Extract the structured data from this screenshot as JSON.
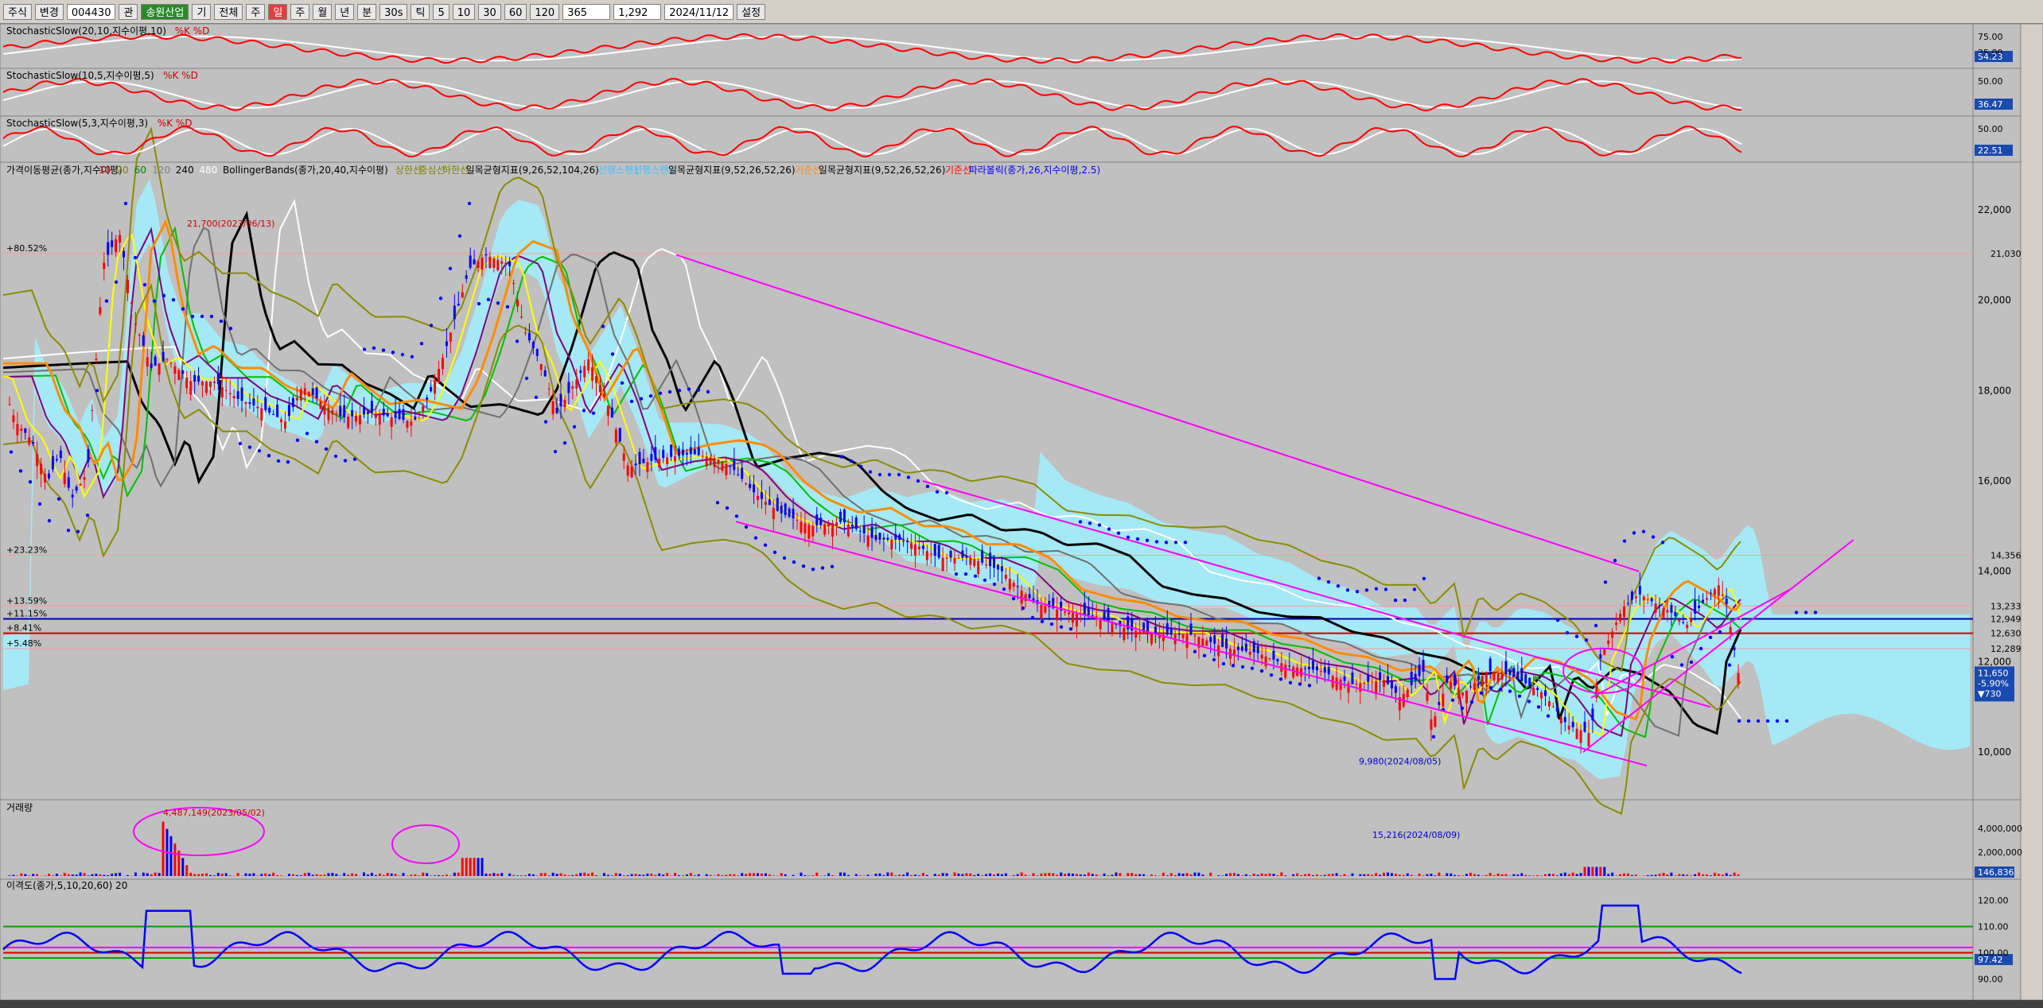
{
  "toolbar": {
    "items": [
      "주식",
      "변경",
      "004430",
      "관",
      "송원산업",
      "기",
      "전체",
      "주",
      "일",
      "주",
      "월",
      "년",
      "분",
      "30s",
      "틱",
      "5",
      "10",
      "30",
      "60",
      "120",
      "365",
      "1,292",
      "2024/11/12",
      "설정"
    ],
    "code": "004430",
    "name": "송원산업",
    "count": "365",
    "total": "1,292",
    "date": "2024/11/12"
  },
  "colors": {
    "bg": "#c0c0c0",
    "up": "#ff0000",
    "down": "#0000ff",
    "magenta": "#ff00ff",
    "cyan": "#a0f0ff",
    "olive": "#8b8b00",
    "yellow": "#ffff00",
    "orange": "#ff8c00",
    "purple": "#800080",
    "green": "#00c000",
    "gray": "#707070",
    "black": "#000000",
    "white": "#ffffff"
  },
  "chart_data": [
    {
      "type": "line",
      "title": "StochasticSlow(20,10,지수이평,10)",
      "legend": [
        "%K",
        "%D"
      ],
      "ylabels": [
        "75.00",
        "25.00"
      ],
      "current": "54.23",
      "series": [
        {
          "name": "%K"
        },
        {
          "name": "%D"
        }
      ]
    },
    {
      "type": "line",
      "title": "StochasticSlow(10,5,지수이평,5)",
      "legend": [
        "%K",
        "%D"
      ],
      "ylabels": [
        "50.00"
      ],
      "current": "36.47"
    },
    {
      "type": "line",
      "title": "StochasticSlow(5,3,지수이평,3)",
      "legend": [
        "%K",
        "%D"
      ],
      "ylabels": [
        "50.00"
      ],
      "current": "22.51"
    },
    {
      "type": "candlestick",
      "legend_items": [
        "가격이동평균(종가,지수이평)",
        "10",
        "20",
        "60",
        "120",
        "240",
        "480",
        "BollingerBands(종가,20,40,지수이평)",
        "상한선",
        "중심선",
        "하한선",
        "일목균형지표(9,26,52,104,26)",
        "선행스팬1",
        "선행스팬2",
        "일목균형지표(9,52,26,52,26)",
        "기준선",
        "일목균형지표(9,52,26,52,26)",
        "기준선",
        "파라볼릭(종가,26,지수이평,2.5)"
      ],
      "ylabels": [
        "22,000",
        "20,000",
        "18,000",
        "16,000",
        "14,000",
        "12,000",
        "10,000"
      ],
      "yticks": [
        22000,
        20000,
        18000,
        16000,
        14000,
        12000,
        10000
      ],
      "ylim": [
        9000,
        23000
      ],
      "price_levels": [
        {
          "pct": "+80.52%",
          "price": "21,030",
          "value": 21030,
          "color": "#ff9999"
        },
        {
          "pct": "+23.23%",
          "price": "14,356",
          "value": 14356,
          "color": "#ff9999"
        },
        {
          "pct": "+13.59%",
          "price": "13,233",
          "value": 13233,
          "color": "#ff9999"
        },
        {
          "pct": "+11.15%",
          "price": "12,949",
          "value": 12949,
          "color": "#0000aa"
        },
        {
          "pct": "+8.41%",
          "price": "12,630",
          "value": 12630,
          "color": "#cc0000"
        },
        {
          "pct": "+5.48%",
          "price": "12,289",
          "value": 12289,
          "color": "#ff9999"
        }
      ],
      "current_price": "11,650",
      "change_pct": "-5.90%",
      "change": "▼730",
      "annotations": [
        {
          "text": "21,700(2023/06/13)",
          "price": 21700
        },
        {
          "text": "9,980(2024/08/05)",
          "price": 9980
        }
      ],
      "x_range_days": "2023/02 ~ 2024/11"
    },
    {
      "type": "bar",
      "title": "거래량",
      "ylabels": [
        "4,000,000",
        "2,000,000"
      ],
      "current": "146,836",
      "annotations": [
        {
          "text": "4,487,149(2023/05/02)"
        },
        {
          "text": "15,216(2024/08/09)"
        }
      ]
    },
    {
      "type": "line",
      "title": "이격도(종가,5,10,20,60)",
      "legend": [
        "20"
      ],
      "ylabels": [
        "120.00",
        "110.00",
        "100.00",
        "90.00"
      ],
      "current": "97.42",
      "reference_lines": [
        110,
        102,
        100,
        98
      ]
    }
  ]
}
